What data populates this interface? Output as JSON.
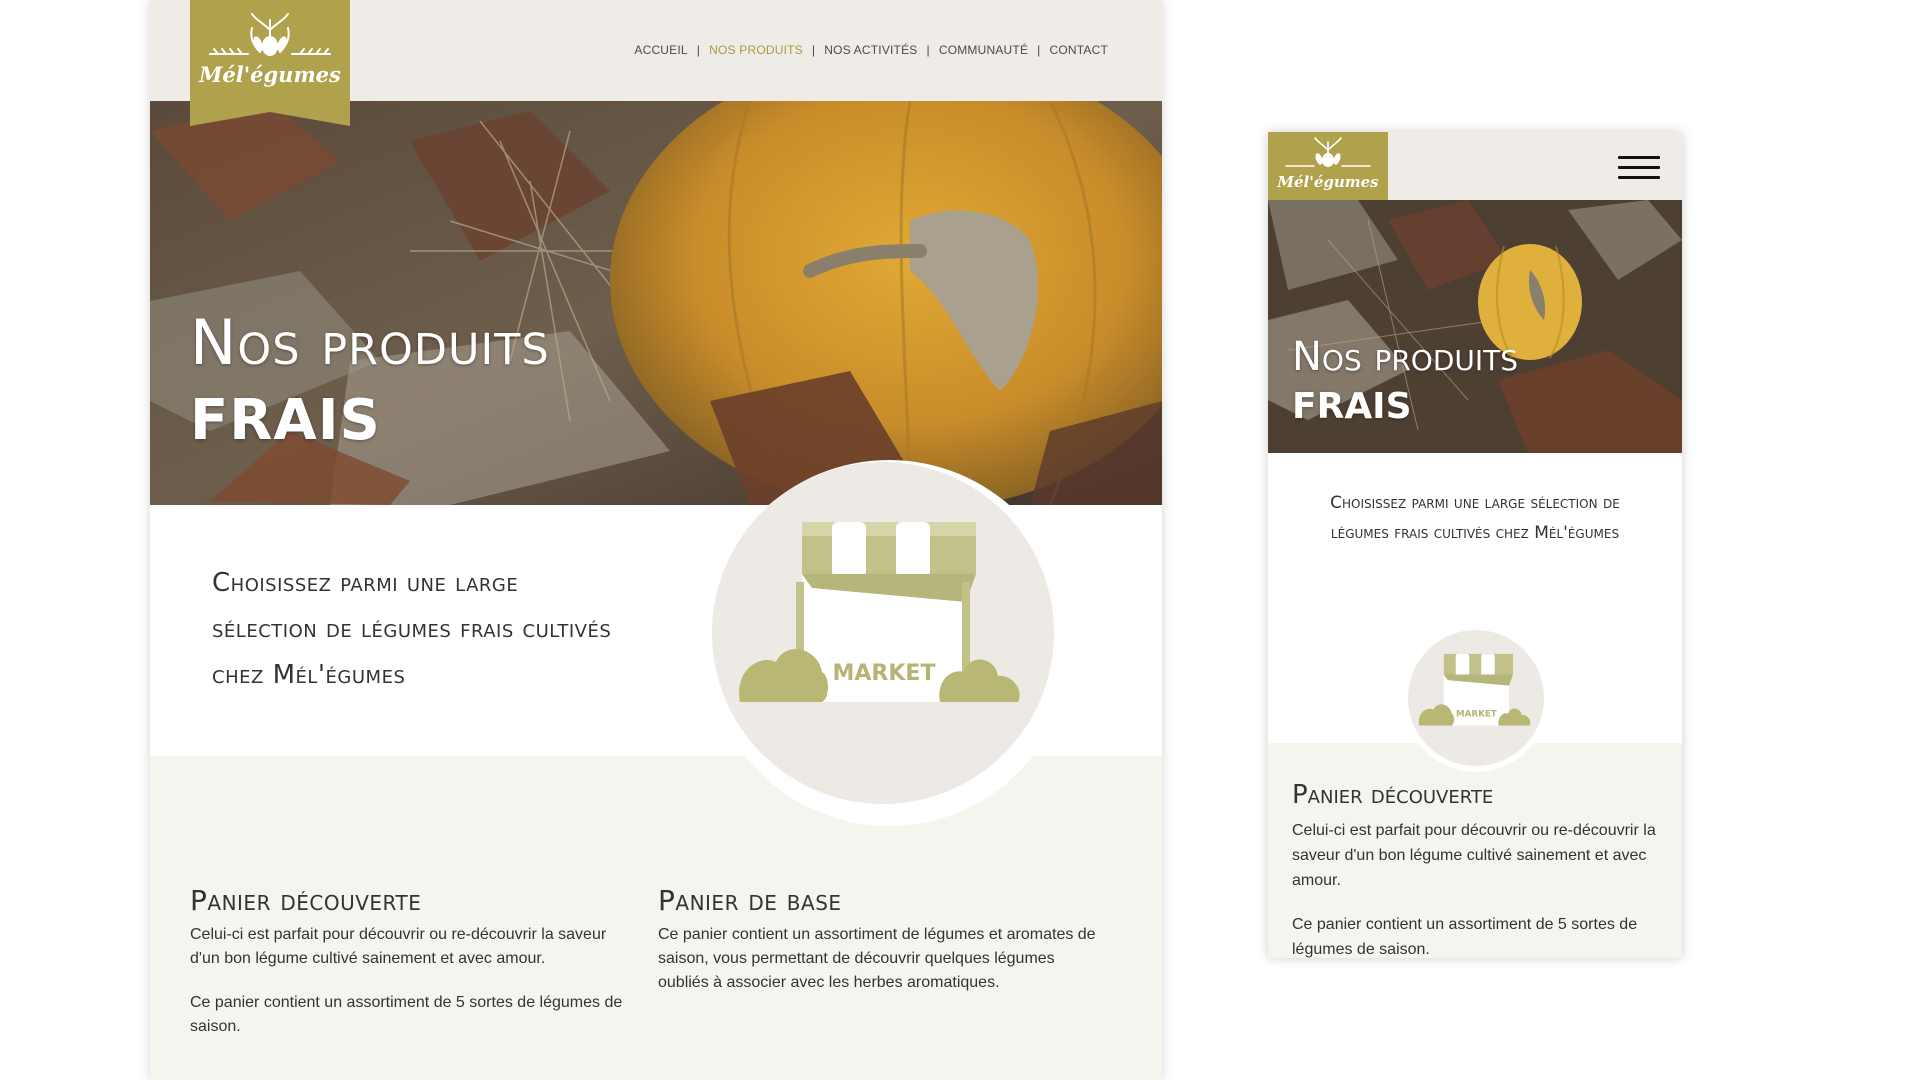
{
  "brand": {
    "name": "Mél'égumes"
  },
  "colors": {
    "accent": "#a89a3e",
    "logo_bg": "#b0a24c",
    "header_bg": "#efece8",
    "band_bg": "#f6f4ef",
    "market_green": "#c2c18a"
  },
  "nav": [
    {
      "label": "ACCUEIL",
      "active": false
    },
    {
      "label": "NOS PRODUITS",
      "active": true
    },
    {
      "label": "NOS ACTIVITÉS",
      "active": false
    },
    {
      "label": "COMMUNAUTÉ",
      "active": false
    },
    {
      "label": "CONTACT",
      "active": false
    }
  ],
  "hero": {
    "line1": "Nos produits",
    "line2": "FRAIS"
  },
  "intro": "Choisissez parmi une large sélection de légumes frais cultivés chez Mél'égumes",
  "market_label": "MARKET",
  "sections": [
    {
      "title": "Panier découverte",
      "paragraphs": [
        "Celui-ci est parfait pour découvrir ou re-découvrir la saveur d'un bon légume cultivé sainement et avec amour.",
        "Ce panier contient un assortiment de 5 sortes de légumes de saison."
      ]
    },
    {
      "title": "Panier de base",
      "paragraphs": [
        "Ce panier contient un assortiment de légumes et aromates de saison, vous permettant de découvrir quelques légumes oubliés à associer avec les herbes aromatiques."
      ]
    }
  ],
  "mobile": {
    "menu_icon": "hamburger-icon",
    "section": {
      "title": "Panier découverte",
      "paragraphs": [
        "Celui-ci est parfait pour découvrir ou re-découvrir la saveur d'un bon légume cultivé sainement et avec amour.",
        "Ce panier contient un assortiment de 5 sortes de légumes de saison."
      ]
    }
  }
}
